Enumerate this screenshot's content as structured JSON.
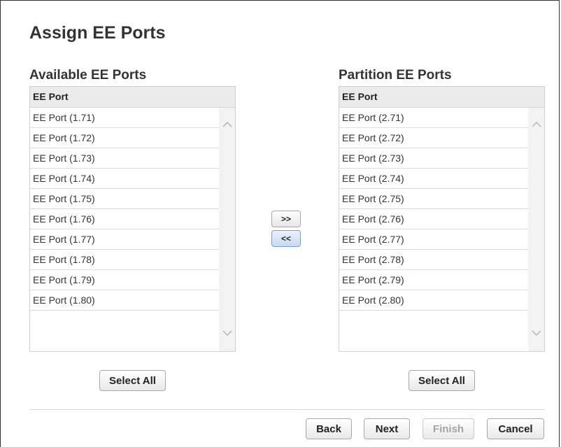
{
  "title": "Assign EE Ports",
  "available": {
    "heading": "Available EE Ports",
    "column_header": "EE Port",
    "items": [
      {
        "label": "EE Port (1.71)"
      },
      {
        "label": "EE Port (1.72)"
      },
      {
        "label": "EE Port (1.73)"
      },
      {
        "label": "EE Port (1.74)"
      },
      {
        "label": "EE Port (1.75)"
      },
      {
        "label": "EE Port (1.76)"
      },
      {
        "label": "EE Port (1.77)"
      },
      {
        "label": "EE Port (1.78)"
      },
      {
        "label": "EE Port (1.79)"
      },
      {
        "label": "EE Port (1.80)"
      }
    ],
    "select_all_label": "Select All"
  },
  "partition": {
    "heading": "Partition EE Ports",
    "column_header": "EE Port",
    "items": [
      {
        "label": "EE Port (2.71)"
      },
      {
        "label": "EE Port (2.72)"
      },
      {
        "label": "EE Port (2.73)"
      },
      {
        "label": "EE Port (2.74)"
      },
      {
        "label": "EE Port (2.75)"
      },
      {
        "label": "EE Port (2.76)"
      },
      {
        "label": "EE Port (2.77)"
      },
      {
        "label": "EE Port (2.78)"
      },
      {
        "label": "EE Port (2.79)"
      },
      {
        "label": "EE Port (2.80)"
      }
    ],
    "select_all_label": "Select All"
  },
  "transfer": {
    "add_label": ">>",
    "remove_label": "<<"
  },
  "footer": {
    "back_label": "Back",
    "next_label": "Next",
    "finish_label": "Finish",
    "cancel_label": "Cancel"
  },
  "icons": {
    "scroll_up": "chevron-up-icon",
    "scroll_down": "chevron-down-icon"
  },
  "colors": {
    "header_bg": "#ebebeb",
    "active_button": "#c9d9ef",
    "disabled_text": "#a5a5a5"
  }
}
